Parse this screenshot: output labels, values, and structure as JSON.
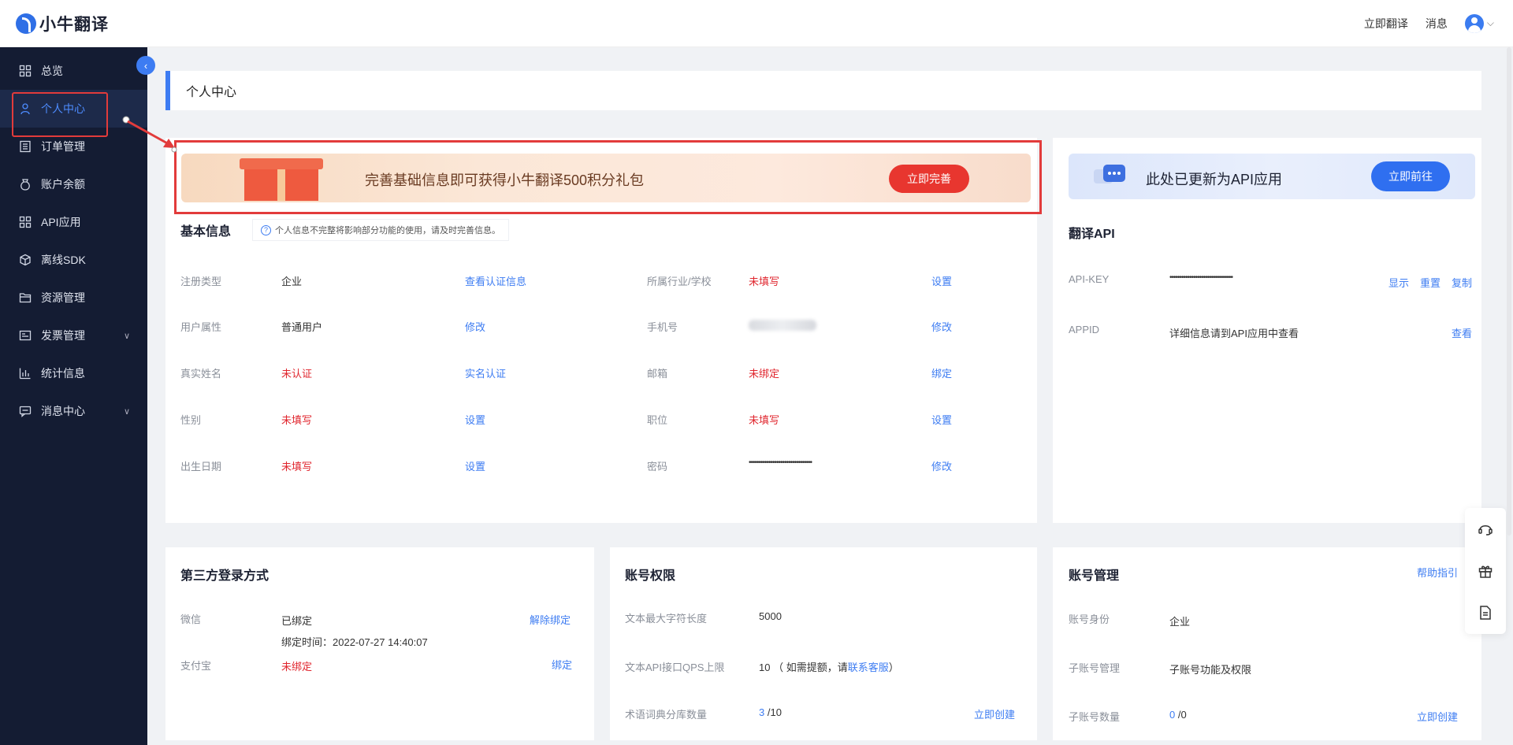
{
  "app": {
    "name": "小牛翻译"
  },
  "topbar": {
    "translate_now": "立即翻译",
    "messages": "消息"
  },
  "sidebar": {
    "items": [
      {
        "label": "总览",
        "icon": "grid-icon"
      },
      {
        "label": "个人中心",
        "icon": "user-icon"
      },
      {
        "label": "订单管理",
        "icon": "list-icon"
      },
      {
        "label": "账户余额",
        "icon": "wallet-icon"
      },
      {
        "label": "API应用",
        "icon": "grid-icon"
      },
      {
        "label": "离线SDK",
        "icon": "cube-icon"
      },
      {
        "label": "资源管理",
        "icon": "folder-icon"
      },
      {
        "label": "发票管理",
        "icon": "invoice-icon"
      },
      {
        "label": "统计信息",
        "icon": "chart-icon"
      },
      {
        "label": "消息中心",
        "icon": "message-icon"
      }
    ]
  },
  "page": {
    "title": "个人中心"
  },
  "banner": {
    "text": "完善基础信息即可获得小牛翻译500积分礼包",
    "button": "立即完善"
  },
  "basic_info": {
    "title": "基本信息",
    "notice": "个人信息不完整将影响部分功能的使用，请及时完善信息。",
    "left": [
      {
        "label": "注册类型",
        "value": "企业",
        "action": "查看认证信息"
      },
      {
        "label": "用户属性",
        "value": "普通用户",
        "action": "修改"
      },
      {
        "label": "真实姓名",
        "value": "未认证",
        "action": "实名认证"
      },
      {
        "label": "性别",
        "value": "未填写",
        "action": "设置"
      },
      {
        "label": "出生日期",
        "value": "未填写",
        "action": "设置"
      }
    ],
    "right": [
      {
        "label": "所属行业/学校",
        "value": "未填写",
        "action": "设置"
      },
      {
        "label": "手机号",
        "value": "",
        "action": "修改"
      },
      {
        "label": "邮箱",
        "value": "未绑定",
        "action": "绑定"
      },
      {
        "label": "职位",
        "value": "未填写",
        "action": "设置"
      },
      {
        "label": "密码",
        "value": "••••••••••••••••••••••••••••••••",
        "action": "修改"
      }
    ]
  },
  "api_banner": {
    "text": "此处已更新为API应用",
    "button": "立即前往"
  },
  "translate_api": {
    "title": "翻译API",
    "key_label": "API-KEY",
    "key_value": "••••••••••••••••••••••••••••••••",
    "show": "显示",
    "reset": "重置",
    "copy": "复制",
    "appid_label": "APPID",
    "appid_value": "详细信息请到API应用中查看",
    "view": "查看"
  },
  "third_party": {
    "title": "第三方登录方式",
    "wechat_label": "微信",
    "wechat_value": "已绑定",
    "wechat_time": "绑定时间：2022-07-27 14:40:07",
    "wechat_action": "解除绑定",
    "alipay_label": "支付宝",
    "alipay_value": "未绑定",
    "alipay_action": "绑定"
  },
  "account_limits": {
    "title": "账号权限",
    "max_chars_label": "文本最大字符长度",
    "max_chars_value": "5000",
    "qps_label": "文本API接口QPS上限",
    "qps_value": "10",
    "qps_note_pre": "（ 如需提额，请",
    "qps_note_link": "联系客服",
    "qps_note_post": "）",
    "dict_label": "术语词典分库数量",
    "dict_used": "3",
    "dict_total": "/10",
    "dict_action": "立即创建"
  },
  "account_mgmt": {
    "title": "账号管理",
    "help": "帮助指引",
    "identity_label": "账号身份",
    "identity_value": "企业",
    "sub_label": "子账号管理",
    "sub_value": "子账号功能及权限",
    "sub_count_label": "子账号数量",
    "sub_count_used": "0",
    "sub_count_total": "/0",
    "sub_count_action": "立即创建"
  },
  "colors": {
    "accent": "#3d7cf2",
    "danger": "#e0262e",
    "sidebar_bg": "#141c33"
  }
}
